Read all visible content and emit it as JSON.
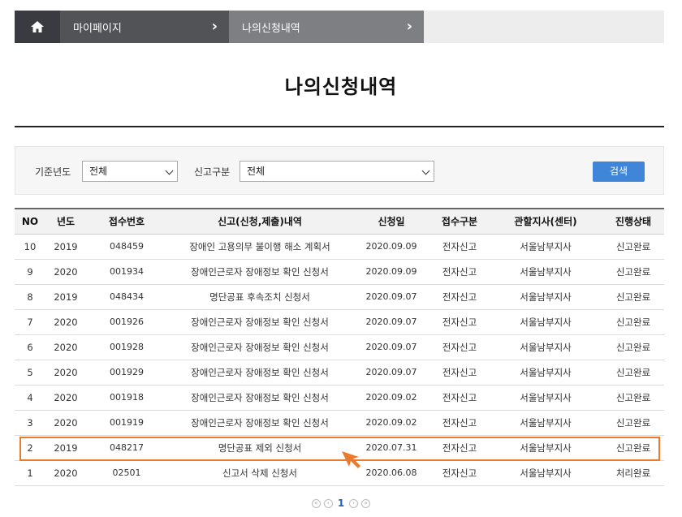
{
  "breadcrumb": {
    "home_icon": "home-icon",
    "items": [
      {
        "label": "마이페이지"
      },
      {
        "label": "나의신청내역"
      }
    ]
  },
  "page_title": "나의신청내역",
  "search": {
    "year_label": "기준년도",
    "year_value": "전체",
    "type_label": "신고구분",
    "type_value": "전체",
    "button_label": "검색",
    "button_color": "#3f86d8"
  },
  "table": {
    "headers": [
      "NO",
      "년도",
      "접수번호",
      "신고(신청,제출)내역",
      "신청일",
      "접수구분",
      "관할지사(센터)",
      "진행상태"
    ],
    "rows": [
      [
        "10",
        "2019",
        "048459",
        "장애인 고용의무 불이행 해소 계획서",
        "2020.09.09",
        "전자신고",
        "서울남부지사",
        "신고완료"
      ],
      [
        "9",
        "2020",
        "001934",
        "장애인근로자 장애정보 확인 신청서",
        "2020.09.09",
        "전자신고",
        "서울남부지사",
        "신고완료"
      ],
      [
        "8",
        "2019",
        "048434",
        "명단공표 후속조치 신청서",
        "2020.09.07",
        "전자신고",
        "서울남부지사",
        "신고완료"
      ],
      [
        "7",
        "2020",
        "001926",
        "장애인근로자 장애정보 확인 신청서",
        "2020.09.07",
        "전자신고",
        "서울남부지사",
        "신고완료"
      ],
      [
        "6",
        "2020",
        "001928",
        "장애인근로자 장애정보 확인 신청서",
        "2020.09.07",
        "전자신고",
        "서울남부지사",
        "신고완료"
      ],
      [
        "5",
        "2020",
        "001929",
        "장애인근로자 장애정보 확인 신청서",
        "2020.09.07",
        "전자신고",
        "서울남부지사",
        "신고완료"
      ],
      [
        "4",
        "2020",
        "001918",
        "장애인근로자 장애정보 확인 신청서",
        "2020.09.02",
        "전자신고",
        "서울남부지사",
        "신고완료"
      ],
      [
        "3",
        "2020",
        "001919",
        "장애인근로자 장애정보 확인 신청서",
        "2020.09.02",
        "전자신고",
        "서울남부지사",
        "신고완료"
      ],
      [
        "2",
        "2019",
        "048217",
        "명단공표 제외 신청서",
        "2020.07.31",
        "전자신고",
        "서울남부지사",
        "신고완료"
      ],
      [
        "1",
        "2020",
        "02501",
        "신고서 삭제 신청서",
        "2020.06.08",
        "전자신고",
        "서울남부지사",
        "처리완료"
      ]
    ],
    "highlighted_row_no": "2",
    "highlight_color": "#ec7a2c"
  },
  "pagination": {
    "current_page": "1",
    "controls": [
      "first-page-icon",
      "prev-page-icon",
      "next-page-icon",
      "last-page-icon"
    ]
  }
}
